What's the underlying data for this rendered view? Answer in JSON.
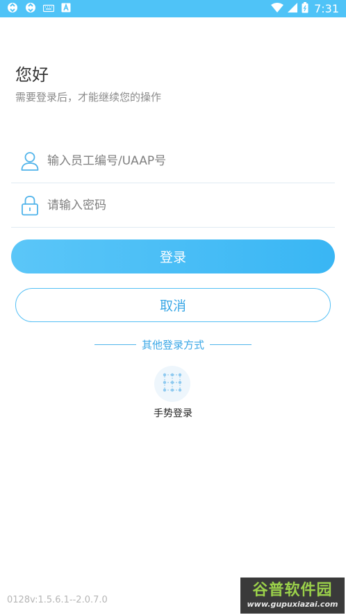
{
  "status_bar": {
    "time": "7:31",
    "left_icons": [
      "sync-icon",
      "sync-icon",
      "keyboard-icon",
      "notification-a-icon"
    ],
    "right_icons": [
      "wifi-icon",
      "signal-icon",
      "battery-icon"
    ]
  },
  "header": {
    "greeting": "您好",
    "subtitle": "需要登录后，才能继续您的操作"
  },
  "form": {
    "username_placeholder": "输入员工编号/UAAP号",
    "username_value": "",
    "password_placeholder": "请输入密码",
    "password_value": ""
  },
  "buttons": {
    "login_label": "登录",
    "cancel_label": "取消"
  },
  "other_login": {
    "title": "其他登录方式",
    "gesture_label": "手势登录"
  },
  "footer": {
    "version": "0128v:1.5.6.1--2.0.7.0"
  },
  "watermark": {
    "text": "谷普软件园",
    "url": "www.gupuxiazai.com"
  },
  "colors": {
    "accent": "#4fc3f7",
    "accent_text": "#3aa7e6",
    "placeholder": "#7f7f7f"
  }
}
